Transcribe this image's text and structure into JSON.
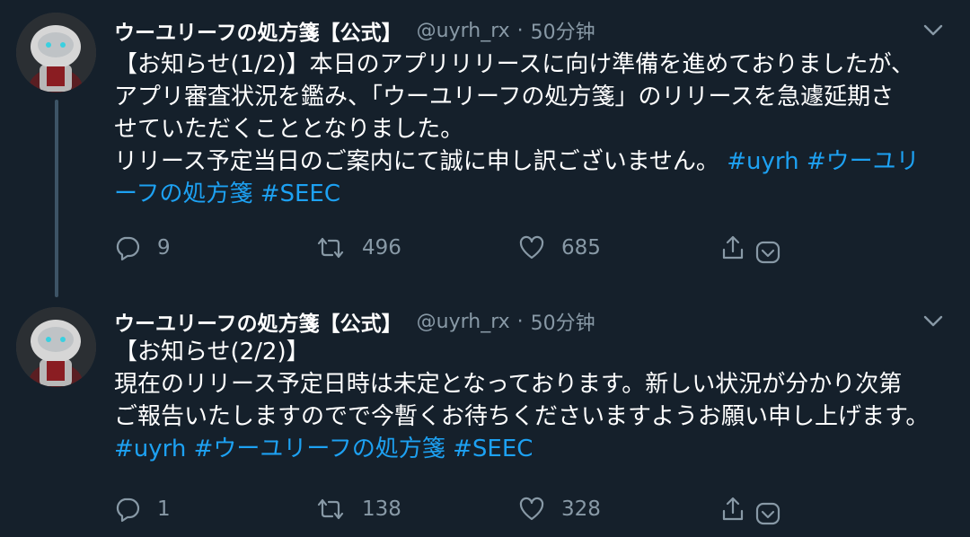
{
  "tweets": [
    {
      "display_name": "ウーユリーフの処方箋【公式】",
      "handle": "@uyrh_rx",
      "separator": "·",
      "time": "50分钟",
      "text_lines": [
        "【お知らせ(1/2)】本日のアプリリリースに向け準備を進めておりましたが、",
        "アプリ審査状況を鑑み、「ウーユリーフの処方箋」のリリースを急遽延期さ",
        "せていただくこととなりました。",
        "リリース予定当日のご案内にて誠に申し訳ございません。"
      ],
      "hashtags": [
        "#uyrh",
        "#ウーユリ",
        "ーフの処方箋",
        "#SEEC"
      ],
      "reply_count": "9",
      "retweet_count": "496",
      "like_count": "685"
    },
    {
      "display_name": "ウーユリーフの処方箋【公式】",
      "handle": "@uyrh_rx",
      "separator": "·",
      "time": "50分钟",
      "text_lines": [
        "【お知らせ(2/2)】",
        "現在のリリース予定日時は未定となっております。新しい状況が分かり次第",
        "ご報告いたしますのでで今暫くお待ちくださいますようお願い申し上げます。"
      ],
      "hashtags": [
        "#uyrh",
        "#ウーユリーフの処方箋",
        "#SEEC"
      ],
      "reply_count": "1",
      "retweet_count": "138",
      "like_count": "328"
    }
  ],
  "icons": {
    "reply": "reply-icon",
    "retweet": "retweet-icon",
    "like": "heart-icon",
    "share": "share-icon",
    "save": "save-icon",
    "more": "chevron-down-icon"
  },
  "colors": {
    "background": "#15202b",
    "text": "#ffffff",
    "muted": "#8899a6",
    "link": "#1da1f2",
    "thread_line": "#3d5466"
  }
}
